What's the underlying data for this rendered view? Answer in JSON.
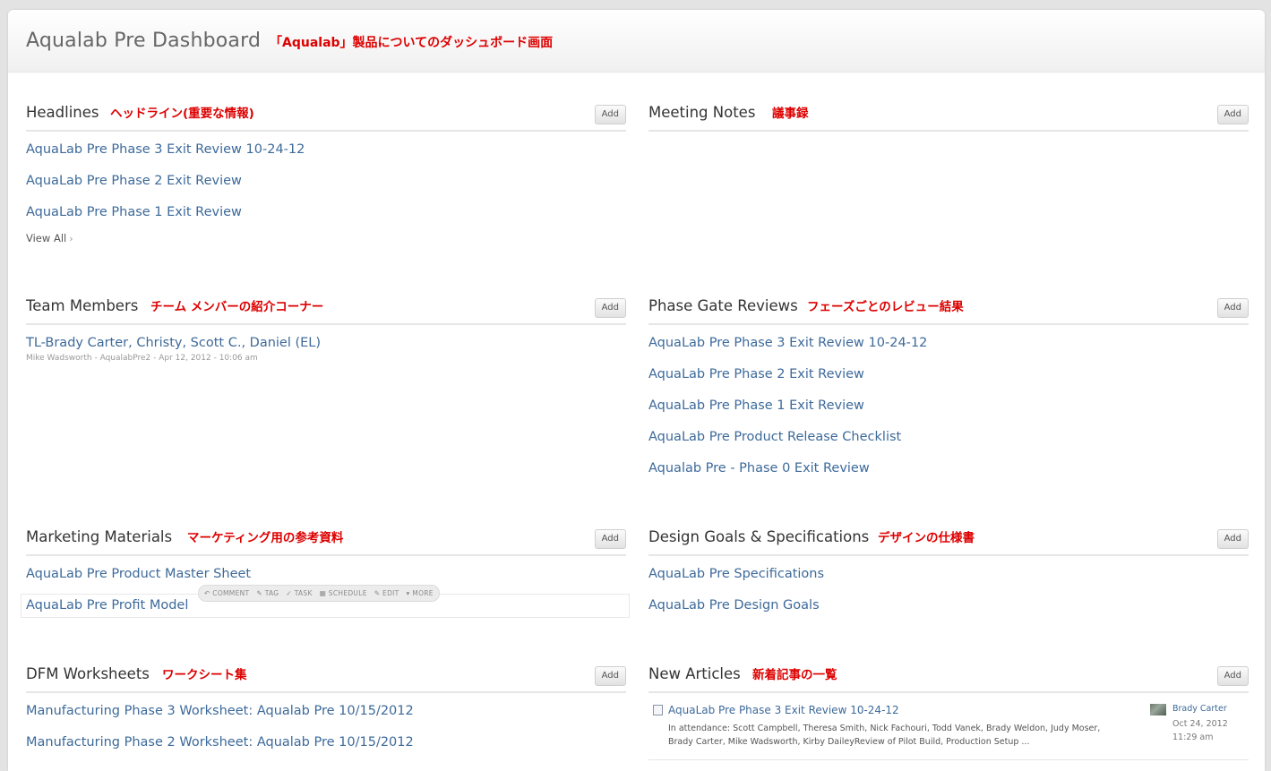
{
  "header": {
    "title": "Aqualab Pre Dashboard",
    "annotation": "「Aqualab」製品についてのダッシュボード画面"
  },
  "add_label": "Add",
  "panels": {
    "headlines": {
      "title": "Headlines",
      "annotation": "ヘッドライン(重要な情報)",
      "items": [
        "AquaLab Pre Phase 3 Exit Review 10-24-12",
        "AquaLab Pre Phase 2 Exit Review",
        "AquaLab Pre Phase 1 Exit Review"
      ],
      "view_all": "View All"
    },
    "meeting_notes": {
      "title": "Meeting Notes",
      "annotation": "議事録"
    },
    "team_members": {
      "title": "Team Members",
      "annotation": "チーム メンバーの紹介コーナー",
      "items": [
        "TL-Brady Carter, Christy, Scott C., Daniel (EL)"
      ],
      "meta": "Mike Wadsworth - AqualabPre2 - Apr 12, 2012 - 10:06 am"
    },
    "phase_gate": {
      "title": "Phase Gate Reviews",
      "annotation": "フェーズごとのレビュー結果",
      "items": [
        "AquaLab Pre Phase 3 Exit Review 10-24-12",
        "AquaLab Pre Phase 2 Exit Review",
        "AquaLab Pre Phase 1 Exit Review",
        "AquaLab Pre Product Release Checklist",
        "Aqualab Pre - Phase 0 Exit Review"
      ]
    },
    "marketing": {
      "title": "Marketing Materials",
      "annotation": "マーケティング用の参考資料",
      "items": [
        "AquaLab Pre Product Master Sheet",
        "AquaLab Pre Profit Model"
      ],
      "actions": [
        "COMMENT",
        "TAG",
        "TASK",
        "SCHEDULE",
        "EDIT",
        "MORE"
      ]
    },
    "design_goals": {
      "title": "Design Goals & Specifications",
      "annotation": "デザインの仕様書",
      "items": [
        "AquaLab Pre Specifications",
        "AquaLab Pre Design Goals"
      ]
    },
    "dfm": {
      "title": "DFM Worksheets",
      "annotation": "ワークシート集",
      "items": [
        "Manufacturing Phase 3 Worksheet: Aqualab Pre 10/15/2012",
        "Manufacturing Phase 2 Worksheet: Aqualab Pre 10/15/2012"
      ]
    },
    "new_articles": {
      "title": "New Articles",
      "annotation": "新着記事の一覧",
      "article": {
        "title": "AquaLab Pre Phase 3 Exit Review 10-24-12",
        "excerpt": "In attendance: Scott Campbell, Theresa Smith, Nick Fachouri, Todd Vanek, Brady Weldon, Judy Moser, Brady Carter, Mike Wadsworth, Kirby DaileyReview of Pilot Build, Production Setup ...",
        "author": "Brady Carter",
        "date": "Oct 24, 2012",
        "time": "11:29 am"
      }
    }
  }
}
